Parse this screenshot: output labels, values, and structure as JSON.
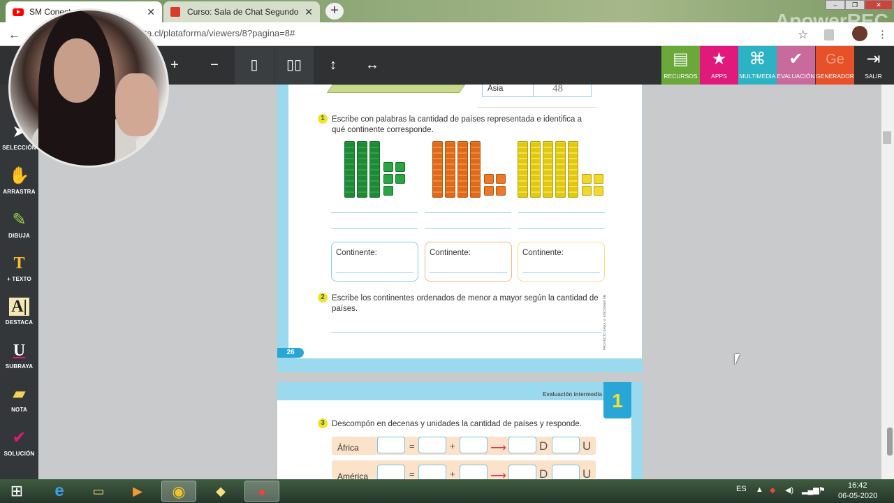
{
  "browser": {
    "tabs": [
      {
        "title": "SM Conecta - 2 S",
        "active": true
      },
      {
        "title": "Curso: Sala de Chat Segundo",
        "active": false
      }
    ],
    "close_glyph": "✕",
    "new_tab_glyph": "+",
    "url": "cta.cl/plataforma/viewers/8?pagina=8#",
    "back_glyph": "←",
    "star_glyph": "☆",
    "watermark": "ApowerREC",
    "window_controls": [
      "–",
      "❐",
      "✕"
    ]
  },
  "toolbar": {
    "buttons": [
      "+",
      "−",
      "▯",
      "▯▯",
      "↕",
      "↔"
    ],
    "apps": [
      {
        "label": "RECURSOS",
        "color": "#6aa83a",
        "icon": "book-icon",
        "glyph": "▤"
      },
      {
        "label": "APPS",
        "color": "#e0197a",
        "icon": "star-icon",
        "glyph": "★"
      },
      {
        "label": "MULTIMEDIA",
        "color": "#2bb3c4",
        "icon": "mouse-icon",
        "glyph": "⌘"
      },
      {
        "label": "EVALUACIÓN",
        "color": "#c96a9c",
        "icon": "check-icon",
        "glyph": "✔"
      },
      {
        "label": "GENERADOR",
        "color": "#e8502a",
        "icon": "generator-icon",
        "glyph": "Ge"
      },
      {
        "label": "SALIR",
        "color": "#2f3133",
        "icon": "exit-icon",
        "glyph": "⇥"
      }
    ]
  },
  "sidebar": {
    "items": [
      {
        "label": "SELECCIÓN",
        "icon": "cursor-icon",
        "glyph": "➤"
      },
      {
        "label": "ARRASTRA",
        "icon": "hand-icon",
        "glyph": "✋"
      },
      {
        "label": "DIBUJA",
        "icon": "pencil-icon",
        "glyph": "✎"
      },
      {
        "label": "+ TEXTO",
        "icon": "text-icon",
        "glyph": "T"
      },
      {
        "label": "DESTACA",
        "icon": "highlight-icon",
        "glyph": "A|"
      },
      {
        "label": "SUBRAYA",
        "icon": "underline-icon",
        "glyph": "U"
      },
      {
        "label": "NOTA",
        "icon": "note-icon",
        "glyph": "▰"
      },
      {
        "label": "SOLUCIÓN",
        "icon": "solution-icon",
        "glyph": "✔"
      }
    ]
  },
  "page1": {
    "table_row_label": "Asia",
    "table_row_value": "48",
    "q1_number": "1",
    "q1_text": "Escribe con palabras la cantidad de países representada e identifica a qué continente corresponde.",
    "continent_label": "Continente:",
    "q2_number": "2",
    "q2_text": "Escribe los continentes ordenados de menor a mayor según la cantidad de países.",
    "page_number": "26",
    "side_text": "PROYECTO SAVIA © EDICIONES SM"
  },
  "blocks": [
    {
      "color": "green",
      "tens": 3,
      "ones": 5
    },
    {
      "color": "orange",
      "tens": 4,
      "ones": 4
    },
    {
      "color": "yellow",
      "tens": 5,
      "ones": 4
    }
  ],
  "page2": {
    "header": "Evaluación intermedia",
    "unit": "1",
    "q3_number": "3",
    "q3_text": "Descompón en decenas y unidades la cantidad de países y responde.",
    "rows": [
      {
        "label": "África",
        "eq": "=",
        "plus": "+",
        "arrow": "⟶",
        "d": "D",
        "u": "U"
      },
      {
        "label": "América",
        "eq": "=",
        "plus": "+",
        "arrow": "⟶",
        "d": "D",
        "u": "U"
      }
    ]
  },
  "taskbar": {
    "lang": "ES",
    "time": "16:42",
    "date": "06-05-2020",
    "apps": [
      {
        "name": "start-orb",
        "glyph": "⊞"
      },
      {
        "name": "ie",
        "glyph": "e"
      },
      {
        "name": "explorer",
        "glyph": "▭"
      },
      {
        "name": "media-player",
        "glyph": "▶"
      },
      {
        "name": "chrome",
        "glyph": "◉"
      },
      {
        "name": "folder",
        "glyph": "◆"
      },
      {
        "name": "recorder",
        "glyph": "●"
      }
    ]
  }
}
